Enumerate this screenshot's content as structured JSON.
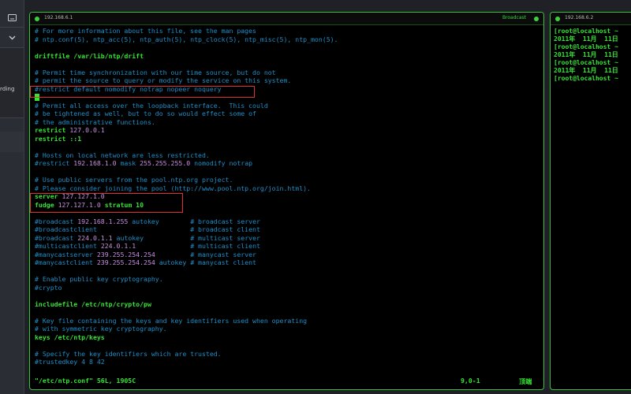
{
  "left_panel": {
    "partial_text": "rding"
  },
  "main_terminal": {
    "title": "192.168.6.1",
    "right_label": "Broadcast",
    "lines": [
      [
        {
          "t": "# For more information about this file, see the man pages",
          "c": "c"
        }
      ],
      [
        {
          "t": "# ntp.conf(5), ntp_acc(5), ntp_auth(5), ntp_clock(5), ntp_misc(5), ntp_mon(5).",
          "c": "c"
        }
      ],
      [],
      [
        {
          "t": "driftfile /var/lib/ntp/drift",
          "c": "g"
        }
      ],
      [],
      [
        {
          "t": "# Permit time synchronization with our time source, but do not",
          "c": "c"
        }
      ],
      [
        {
          "t": "# permit the source to query or modify the service on this system.",
          "c": "c"
        }
      ],
      [
        {
          "t": "#restrict default nomodify notrap nopeer noquery",
          "c": "c"
        }
      ],
      [
        {
          "t": "",
          "c": "cursor"
        }
      ],
      [
        {
          "t": "# Permit all access over the loopback interface.  This could",
          "c": "c"
        }
      ],
      [
        {
          "t": "# be tightened as well, but to do so would effect some of",
          "c": "c"
        }
      ],
      [
        {
          "t": "# the administrative functions.",
          "c": "c"
        }
      ],
      [
        {
          "t": "restrict ",
          "c": "g"
        },
        {
          "t": "127.0.0.1",
          "c": "n"
        }
      ],
      [
        {
          "t": "restrict ::1",
          "c": "g"
        }
      ],
      [],
      [
        {
          "t": "# Hosts on local network are less restricted.",
          "c": "c"
        }
      ],
      [
        {
          "t": "#restrict ",
          "c": "c"
        },
        {
          "t": "192.168.1.0",
          "c": "n"
        },
        {
          "t": " mask ",
          "c": "c"
        },
        {
          "t": "255.255.255.0",
          "c": "n"
        },
        {
          "t": " nomodify notrap",
          "c": "c"
        }
      ],
      [],
      [
        {
          "t": "# Use public servers from the pool.ntp.org project.",
          "c": "c"
        }
      ],
      [
        {
          "t": "# Please consider joining the pool (http://www.pool.ntp.org/join.html).",
          "c": "c"
        }
      ],
      [
        {
          "t": "server ",
          "c": "g"
        },
        {
          "t": "127.127.1.0",
          "c": "n"
        }
      ],
      [
        {
          "t": "fudge ",
          "c": "g"
        },
        {
          "t": "127.127.1.0",
          "c": "n"
        },
        {
          "t": " stratum 10",
          "c": "g"
        }
      ],
      [],
      [
        {
          "t": "#broadcast ",
          "c": "c"
        },
        {
          "t": "192.168.1.255",
          "c": "n"
        },
        {
          "t": " autokey        # broadcast server",
          "c": "c"
        }
      ],
      [
        {
          "t": "#broadcastclient                        # broadcast client",
          "c": "c"
        }
      ],
      [
        {
          "t": "#broadcast ",
          "c": "c"
        },
        {
          "t": "224.0.1.1",
          "c": "n"
        },
        {
          "t": " autokey            # multicast server",
          "c": "c"
        }
      ],
      [
        {
          "t": "#multicastclient ",
          "c": "c"
        },
        {
          "t": "224.0.1.1",
          "c": "n"
        },
        {
          "t": "              # multicast client",
          "c": "c"
        }
      ],
      [
        {
          "t": "#manycastserver ",
          "c": "c"
        },
        {
          "t": "239.255.254.254",
          "c": "n"
        },
        {
          "t": "         # manycast server",
          "c": "c"
        }
      ],
      [
        {
          "t": "#manycastclient ",
          "c": "c"
        },
        {
          "t": "239.255.254.254",
          "c": "n"
        },
        {
          "t": " autokey # manycast client",
          "c": "c"
        }
      ],
      [],
      [
        {
          "t": "# Enable public key cryptography.",
          "c": "c"
        }
      ],
      [
        {
          "t": "#crypto",
          "c": "c"
        }
      ],
      [],
      [
        {
          "t": "includefile /etc/ntp/crypto/pw",
          "c": "g"
        }
      ],
      [],
      [
        {
          "t": "# Key file containing the keys and key identifiers used when operating",
          "c": "c"
        }
      ],
      [
        {
          "t": "# with symmetric key cryptography.",
          "c": "c"
        }
      ],
      [
        {
          "t": "keys /etc/ntp/keys",
          "c": "g"
        }
      ],
      [],
      [
        {
          "t": "# Specify the key identifiers which are trusted.",
          "c": "c"
        }
      ],
      [
        {
          "t": "#trustedkey 4 8 42",
          "c": "c"
        }
      ]
    ],
    "status": {
      "file": "\"/etc/ntp.conf\" 56L, 1905C",
      "position": "9,0-1",
      "scroll": "顶端"
    }
  },
  "right_terminal": {
    "title": "192.168.6.2",
    "lines": [
      "[root@localhost ~",
      "2011年  11月  11日",
      "[root@localhost ~",
      "2011年  11月  11日",
      "[root@localhost ~",
      "2011年  11月  11日",
      "[root@localhost ~"
    ]
  },
  "colors": {
    "comment": "#1e8fc8",
    "keyword": "#36e336",
    "number": "#c88ee0",
    "highlight_box": "#e03030",
    "terminal_border": "#3bc23b"
  }
}
